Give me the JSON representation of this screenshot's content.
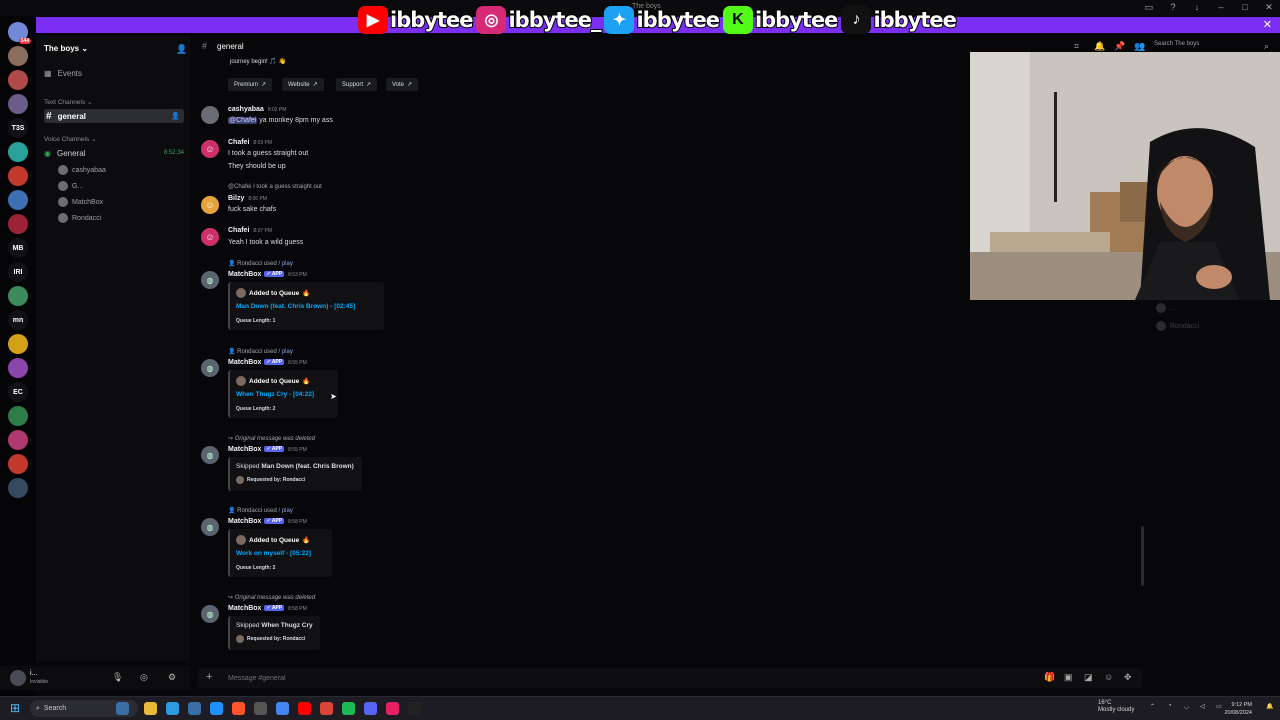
{
  "window": {
    "title": "The boys"
  },
  "overlay": {
    "socials": [
      {
        "platform": "youtube-icon",
        "handle": "ibbytee",
        "color": "#ff0000"
      },
      {
        "platform": "instagram-icon",
        "handle": "ibbytee_",
        "color": "#d62976"
      },
      {
        "platform": "twitter-icon",
        "handle": "ibbytee",
        "color": "#1da1f2"
      },
      {
        "platform": "kick-icon",
        "handle": "ibbytee",
        "color": "#53fc18"
      },
      {
        "platform": "tiktok-icon",
        "handle": "ibbytee",
        "color": "#111111"
      }
    ]
  },
  "rail": {
    "servers": [
      {
        "label": "",
        "badge": "144",
        "color": "#7289da"
      },
      {
        "label": "",
        "badge": "",
        "color": "#8a6d5a"
      },
      {
        "label": "",
        "badge": "",
        "color": "#b04a4a"
      },
      {
        "label": "",
        "badge": "",
        "color": "#6a5d8a"
      },
      {
        "label": "T3S",
        "badge": "",
        "color": "#121215"
      },
      {
        "label": "",
        "badge": "",
        "color": "#2aa198"
      },
      {
        "label": "",
        "badge": "",
        "color": "#c0392b"
      },
      {
        "label": "",
        "badge": "",
        "color": "#3d6fb5"
      },
      {
        "label": "",
        "badge": "",
        "color": "#9b2335"
      },
      {
        "label": "MB",
        "badge": "",
        "color": "#121215"
      },
      {
        "label": "IRI",
        "badge": "",
        "color": "#121215"
      },
      {
        "label": "",
        "badge": "",
        "color": "#3b8a5a"
      },
      {
        "label": "mn",
        "badge": "",
        "color": "#121215"
      },
      {
        "label": "",
        "badge": "",
        "color": "#d4a017"
      },
      {
        "label": "",
        "badge": "",
        "color": "#8e44ad"
      },
      {
        "label": "EC",
        "badge": "",
        "color": "#121215"
      },
      {
        "label": "",
        "badge": "",
        "color": "#2d7d46"
      },
      {
        "label": "",
        "badge": "",
        "color": "#b03a6e"
      },
      {
        "label": "",
        "badge": "",
        "color": "#c0392b"
      },
      {
        "label": "",
        "badge": "",
        "color": "#34495e"
      }
    ]
  },
  "sidebar": {
    "server_name": "The boys",
    "events_label": "Events",
    "text_category": "Text Channels",
    "text_channel": "general",
    "voice_category": "Voice Channels",
    "voice_channel": "General",
    "voice_timer": "8:52:34",
    "voice_users": [
      "cashyabaa",
      "G...",
      "MatchBox",
      "Rondacci"
    ]
  },
  "user_panel": {
    "name": "i...",
    "status": "Invisible"
  },
  "chat": {
    "channel": "general",
    "search_placeholder": "Search The boys",
    "composer_placeholder": "Message #general"
  },
  "messages": {
    "top_line": "journey begin! 🎵 👋",
    "buttons": [
      "Premium",
      "Website",
      "Support",
      "Vote"
    ],
    "m1": {
      "author": "cashyabaa",
      "time": "8:02 PM",
      "mention": "@Chafei",
      "text": "ya monkey 8pm my ass"
    },
    "m2": {
      "author": "Chafei",
      "time": "8:03 PM",
      "line1": "I took a guess straight out",
      "line2": "They should be up"
    },
    "m3": {
      "reply": "@Chafei I took a guess straight out",
      "author": "Bilzy",
      "time": "8:06 PM",
      "text": "fuck sake chafs"
    },
    "m4": {
      "author": "Chafei",
      "time": "8:07 PM",
      "text": "Yeah I took a wild guess"
    },
    "q1": {
      "user": "Rondacci",
      "used": "used",
      "cmd": "/ play",
      "author": "MatchBox",
      "tag": "APP",
      "time": "8:53 PM",
      "title": "Added to Queue",
      "link": "Man Down (feat. Chris Brown) - [02:45]",
      "sub": "Queue Length: 1"
    },
    "q2": {
      "user": "Rondacci",
      "used": "used",
      "cmd": "/ play",
      "author": "MatchBox",
      "tag": "APP",
      "time": "8:55 PM",
      "title": "Added to Queue",
      "link": "When Thugz Cry - [04:22]",
      "sub": "Queue Length: 2"
    },
    "s1": {
      "reply": "Original message was deleted",
      "author": "MatchBox",
      "tag": "APP",
      "time": "8:55 PM",
      "text_prefix": "Skipped",
      "song": "Man Down (feat. Chris Brown)",
      "req": "Requested by: Rondacci"
    },
    "q3": {
      "user": "Rondacci",
      "used": "used",
      "cmd": "/ play",
      "author": "MatchBox",
      "tag": "APP",
      "time": "8:58 PM",
      "title": "Added to Queue",
      "link": "Work on myself - [05:22]",
      "sub": "Queue Length: 2"
    },
    "s2": {
      "reply": "Original message was deleted",
      "author": "MatchBox",
      "tag": "APP",
      "time": "8:58 PM",
      "text_prefix": "Skipped",
      "song": "When Thugz Cry",
      "req": "Requested by: Rondacci"
    }
  },
  "right_list": {
    "users": [
      "...",
      "Rondacci"
    ]
  },
  "taskbar": {
    "search_label": "Search",
    "weather_temp": "16°C",
    "weather_desc": "Mostly cloudy",
    "time": "9:12 PM",
    "date": "20/08/2024"
  }
}
